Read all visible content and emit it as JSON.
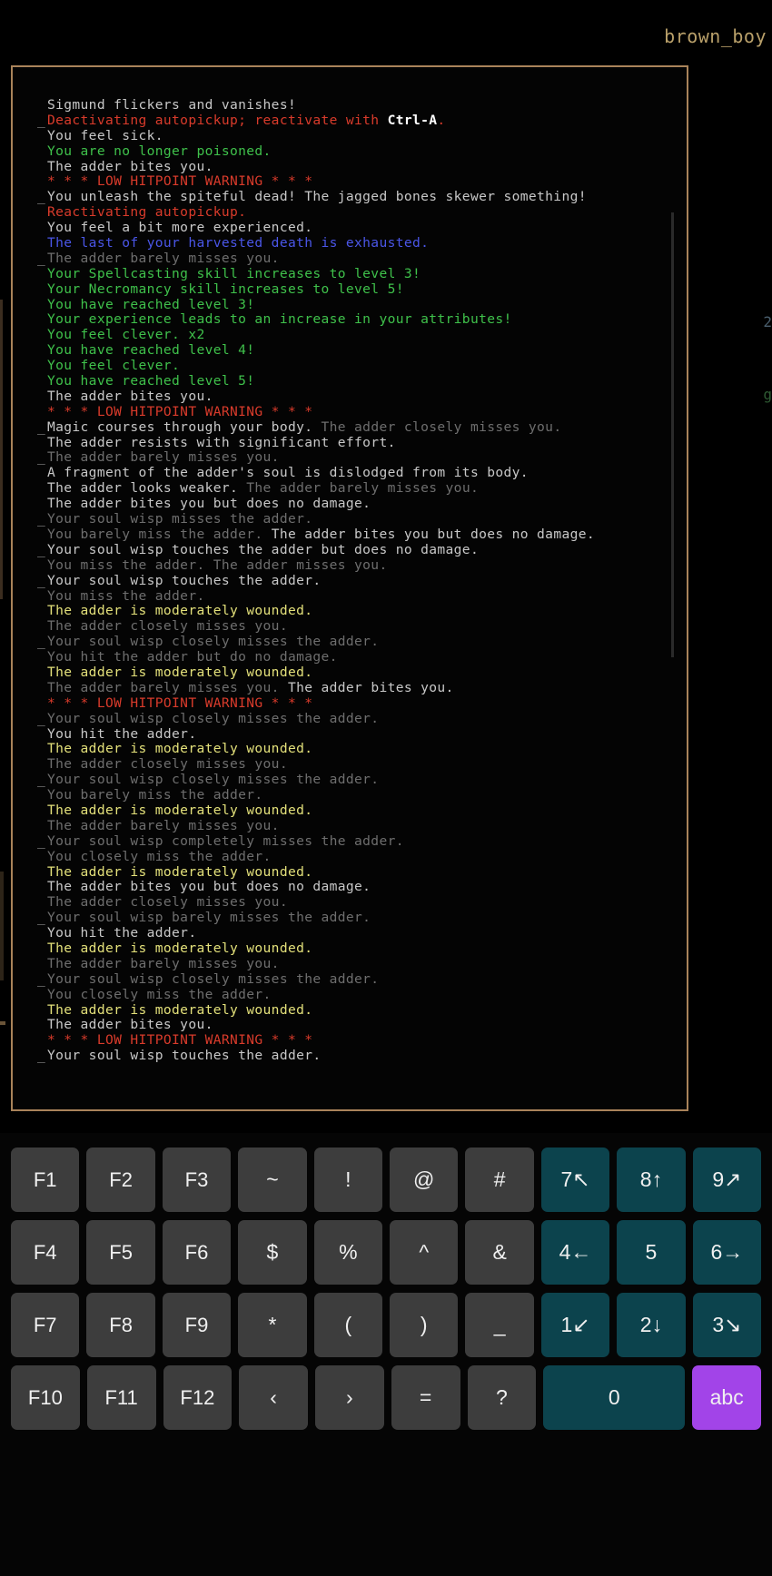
{
  "window": {
    "player_name": "brown_boy",
    "accent_border": "#a9835a",
    "background": "#000000"
  },
  "hud": {
    "right_fragment_1": "2",
    "right_fragment_2": "g"
  },
  "message_log": {
    "lines": [
      {
        "cont": false,
        "segments": [
          {
            "text": "Sigmund flickers and vanishes!",
            "color": "plain"
          }
        ]
      },
      {
        "cont": true,
        "segments": [
          {
            "text": "Deactivating autopickup; reactivate with ",
            "color": "red"
          },
          {
            "text": "Ctrl-A",
            "color": "bold"
          },
          {
            "text": ".",
            "color": "red"
          }
        ]
      },
      {
        "cont": false,
        "segments": [
          {
            "text": "You feel sick.",
            "color": "plain"
          }
        ]
      },
      {
        "cont": false,
        "segments": [
          {
            "text": "You are no longer poisoned.",
            "color": "green"
          }
        ]
      },
      {
        "cont": false,
        "segments": [
          {
            "text": "The adder bites you.",
            "color": "plain"
          }
        ]
      },
      {
        "cont": false,
        "segments": [
          {
            "text": "* * * LOW HITPOINT WARNING * * *",
            "color": "red"
          }
        ]
      },
      {
        "cont": true,
        "segments": [
          {
            "text": "You unleash the spiteful dead! The jagged bones skewer something!",
            "color": "plain"
          }
        ]
      },
      {
        "cont": false,
        "segments": [
          {
            "text": "Reactivating autopickup.",
            "color": "red"
          }
        ]
      },
      {
        "cont": false,
        "segments": [
          {
            "text": "You feel a bit more experienced.",
            "color": "plain"
          }
        ]
      },
      {
        "cont": false,
        "segments": [
          {
            "text": "The last of your harvested death is exhausted.",
            "color": "blue"
          }
        ]
      },
      {
        "cont": true,
        "segments": [
          {
            "text": "The adder barely misses you.",
            "color": "dim"
          }
        ]
      },
      {
        "cont": false,
        "segments": [
          {
            "text": "Your Spellcasting skill increases to level 3!",
            "color": "green"
          }
        ]
      },
      {
        "cont": false,
        "segments": [
          {
            "text": "Your Necromancy skill increases to level 5!",
            "color": "green"
          }
        ]
      },
      {
        "cont": false,
        "segments": [
          {
            "text": "You have reached level 3!",
            "color": "green"
          }
        ]
      },
      {
        "cont": false,
        "segments": [
          {
            "text": "Your experience leads to an increase in your attributes!",
            "color": "green"
          }
        ]
      },
      {
        "cont": false,
        "segments": [
          {
            "text": "You feel clever. x2",
            "color": "green"
          }
        ]
      },
      {
        "cont": false,
        "segments": [
          {
            "text": "You have reached level 4!",
            "color": "green"
          }
        ]
      },
      {
        "cont": false,
        "segments": [
          {
            "text": "You feel clever.",
            "color": "green"
          }
        ]
      },
      {
        "cont": false,
        "segments": [
          {
            "text": "You have reached level 5!",
            "color": "green"
          }
        ]
      },
      {
        "cont": false,
        "segments": [
          {
            "text": "The adder bites you.",
            "color": "plain"
          }
        ]
      },
      {
        "cont": false,
        "segments": [
          {
            "text": "* * * LOW HITPOINT WARNING * * *",
            "color": "red"
          }
        ]
      },
      {
        "cont": true,
        "segments": [
          {
            "text": "Magic courses through your body. ",
            "color": "plain"
          },
          {
            "text": "The adder closely misses you.",
            "color": "dim"
          }
        ]
      },
      {
        "cont": false,
        "segments": [
          {
            "text": "The adder resists with significant effort.",
            "color": "plain"
          }
        ]
      },
      {
        "cont": true,
        "segments": [
          {
            "text": "The adder barely misses you.",
            "color": "dim"
          }
        ]
      },
      {
        "cont": false,
        "segments": [
          {
            "text": "A fragment of the adder's soul is dislodged from its body.",
            "color": "plain"
          }
        ]
      },
      {
        "cont": false,
        "segments": [
          {
            "text": "The adder looks weaker. ",
            "color": "plain"
          },
          {
            "text": "The adder barely misses you.",
            "color": "dim"
          }
        ]
      },
      {
        "cont": false,
        "segments": [
          {
            "text": "The adder bites you but does no damage.",
            "color": "plain"
          }
        ]
      },
      {
        "cont": true,
        "segments": [
          {
            "text": "Your soul wisp misses the adder.",
            "color": "dim"
          }
        ]
      },
      {
        "cont": false,
        "segments": [
          {
            "text": "You barely miss the adder. ",
            "color": "dim"
          },
          {
            "text": "The adder bites you but does no damage.",
            "color": "plain"
          }
        ]
      },
      {
        "cont": true,
        "segments": [
          {
            "text": "Your soul wisp touches the adder but does no damage.",
            "color": "plain"
          }
        ]
      },
      {
        "cont": false,
        "segments": [
          {
            "text": "You miss the adder. The adder misses you.",
            "color": "dim"
          }
        ]
      },
      {
        "cont": true,
        "segments": [
          {
            "text": "Your soul wisp touches the adder.",
            "color": "plain"
          }
        ]
      },
      {
        "cont": false,
        "segments": [
          {
            "text": "You miss the adder.",
            "color": "dim"
          }
        ]
      },
      {
        "cont": false,
        "segments": [
          {
            "text": "The adder is moderately wounded.",
            "color": "yellow"
          }
        ]
      },
      {
        "cont": false,
        "segments": [
          {
            "text": "The adder closely misses you.",
            "color": "dim"
          }
        ]
      },
      {
        "cont": true,
        "segments": [
          {
            "text": "Your soul wisp closely misses the adder.",
            "color": "dim"
          }
        ]
      },
      {
        "cont": false,
        "segments": [
          {
            "text": "You hit the adder but do no damage.",
            "color": "dim"
          }
        ]
      },
      {
        "cont": false,
        "segments": [
          {
            "text": "The adder is moderately wounded.",
            "color": "yellow"
          }
        ]
      },
      {
        "cont": false,
        "segments": [
          {
            "text": "The adder barely misses you. ",
            "color": "dim"
          },
          {
            "text": "The adder bites you.",
            "color": "plain"
          }
        ]
      },
      {
        "cont": false,
        "segments": [
          {
            "text": "* * * LOW HITPOINT WARNING * * *",
            "color": "red"
          }
        ]
      },
      {
        "cont": true,
        "segments": [
          {
            "text": "Your soul wisp closely misses the adder.",
            "color": "dim"
          }
        ]
      },
      {
        "cont": false,
        "segments": [
          {
            "text": "You hit the adder.",
            "color": "plain"
          }
        ]
      },
      {
        "cont": false,
        "segments": [
          {
            "text": "The adder is moderately wounded.",
            "color": "yellow"
          }
        ]
      },
      {
        "cont": false,
        "segments": [
          {
            "text": "The adder closely misses you.",
            "color": "dim"
          }
        ]
      },
      {
        "cont": true,
        "segments": [
          {
            "text": "Your soul wisp closely misses the adder.",
            "color": "dim"
          }
        ]
      },
      {
        "cont": false,
        "segments": [
          {
            "text": "You barely miss the adder.",
            "color": "dim"
          }
        ]
      },
      {
        "cont": false,
        "segments": [
          {
            "text": "The adder is moderately wounded.",
            "color": "yellow"
          }
        ]
      },
      {
        "cont": false,
        "segments": [
          {
            "text": "The adder barely misses you.",
            "color": "dim"
          }
        ]
      },
      {
        "cont": true,
        "segments": [
          {
            "text": "Your soul wisp completely misses the adder.",
            "color": "dim"
          }
        ]
      },
      {
        "cont": false,
        "segments": [
          {
            "text": "You closely miss the adder.",
            "color": "dim"
          }
        ]
      },
      {
        "cont": false,
        "segments": [
          {
            "text": "The adder is moderately wounded.",
            "color": "yellow"
          }
        ]
      },
      {
        "cont": false,
        "segments": [
          {
            "text": "The adder bites you but does no damage.",
            "color": "plain"
          }
        ]
      },
      {
        "cont": false,
        "segments": [
          {
            "text": "The adder closely misses you.",
            "color": "dim"
          }
        ]
      },
      {
        "cont": true,
        "segments": [
          {
            "text": "Your soul wisp barely misses the adder.",
            "color": "dim"
          }
        ]
      },
      {
        "cont": false,
        "segments": [
          {
            "text": "You hit the adder.",
            "color": "plain"
          }
        ]
      },
      {
        "cont": false,
        "segments": [
          {
            "text": "The adder is moderately wounded.",
            "color": "yellow"
          }
        ]
      },
      {
        "cont": false,
        "segments": [
          {
            "text": "The adder barely misses you.",
            "color": "dim"
          }
        ]
      },
      {
        "cont": true,
        "segments": [
          {
            "text": "Your soul wisp closely misses the adder.",
            "color": "dim"
          }
        ]
      },
      {
        "cont": false,
        "segments": [
          {
            "text": "You closely miss the adder.",
            "color": "dim"
          }
        ]
      },
      {
        "cont": false,
        "segments": [
          {
            "text": "The adder is moderately wounded.",
            "color": "yellow"
          }
        ]
      },
      {
        "cont": false,
        "segments": [
          {
            "text": "The adder bites you.",
            "color": "plain"
          }
        ]
      },
      {
        "cont": false,
        "segments": [
          {
            "text": "* * * LOW HITPOINT WARNING * * *",
            "color": "red"
          }
        ]
      },
      {
        "cont": true,
        "segments": [
          {
            "text": "Your soul wisp touches the adder.",
            "color": "plain"
          }
        ]
      }
    ]
  },
  "keyboard": {
    "colors": {
      "default_key": "#3d3d3d",
      "numpad_key": "#0c434d",
      "mode_key": "#a244e8"
    },
    "rows": [
      [
        {
          "label": "F1",
          "name": "key-f1",
          "style": "default"
        },
        {
          "label": "F2",
          "name": "key-f2",
          "style": "default"
        },
        {
          "label": "F3",
          "name": "key-f3",
          "style": "default"
        },
        {
          "label": "~",
          "name": "key-tilde",
          "style": "default"
        },
        {
          "label": "!",
          "name": "key-exclamation",
          "style": "default"
        },
        {
          "label": "@",
          "name": "key-at",
          "style": "default"
        },
        {
          "label": "#",
          "name": "key-hash",
          "style": "default"
        },
        {
          "label": "7↖",
          "name": "key-numpad-7-upleft",
          "style": "teal"
        },
        {
          "label": "8↑",
          "name": "key-numpad-8-up",
          "style": "teal"
        },
        {
          "label": "9↗",
          "name": "key-numpad-9-upright",
          "style": "teal"
        }
      ],
      [
        {
          "label": "F4",
          "name": "key-f4",
          "style": "default"
        },
        {
          "label": "F5",
          "name": "key-f5",
          "style": "default"
        },
        {
          "label": "F6",
          "name": "key-f6",
          "style": "default"
        },
        {
          "label": "$",
          "name": "key-dollar",
          "style": "default"
        },
        {
          "label": "%",
          "name": "key-percent",
          "style": "default"
        },
        {
          "label": "^",
          "name": "key-caret",
          "style": "default"
        },
        {
          "label": "&",
          "name": "key-ampersand",
          "style": "default"
        },
        {
          "label": "4←",
          "name": "key-numpad-4-left",
          "style": "teal"
        },
        {
          "label": "5",
          "name": "key-numpad-5",
          "style": "teal"
        },
        {
          "label": "6→",
          "name": "key-numpad-6-right",
          "style": "teal"
        }
      ],
      [
        {
          "label": "F7",
          "name": "key-f7",
          "style": "default"
        },
        {
          "label": "F8",
          "name": "key-f8",
          "style": "default"
        },
        {
          "label": "F9",
          "name": "key-f9",
          "style": "default"
        },
        {
          "label": "*",
          "name": "key-asterisk",
          "style": "default"
        },
        {
          "label": "(",
          "name": "key-paren-open",
          "style": "default"
        },
        {
          "label": ")",
          "name": "key-paren-close",
          "style": "default"
        },
        {
          "label": "_",
          "name": "key-underscore",
          "style": "default"
        },
        {
          "label": "1↙",
          "name": "key-numpad-1-downleft",
          "style": "teal"
        },
        {
          "label": "2↓",
          "name": "key-numpad-2-down",
          "style": "teal"
        },
        {
          "label": "3↘",
          "name": "key-numpad-3-downright",
          "style": "teal"
        }
      ],
      [
        {
          "label": "F10",
          "name": "key-f10",
          "style": "default"
        },
        {
          "label": "F11",
          "name": "key-f11",
          "style": "default"
        },
        {
          "label": "F12",
          "name": "key-f12",
          "style": "default"
        },
        {
          "label": "‹",
          "name": "key-angle-left",
          "style": "default"
        },
        {
          "label": "›",
          "name": "key-angle-right",
          "style": "default"
        },
        {
          "label": "=",
          "name": "key-equals",
          "style": "default"
        },
        {
          "label": "?",
          "name": "key-question",
          "style": "default"
        },
        {
          "label": "0",
          "name": "key-numpad-0",
          "style": "teal",
          "wide": true
        },
        {
          "label": "abc",
          "name": "key-abc-mode",
          "style": "purple"
        }
      ]
    ]
  }
}
